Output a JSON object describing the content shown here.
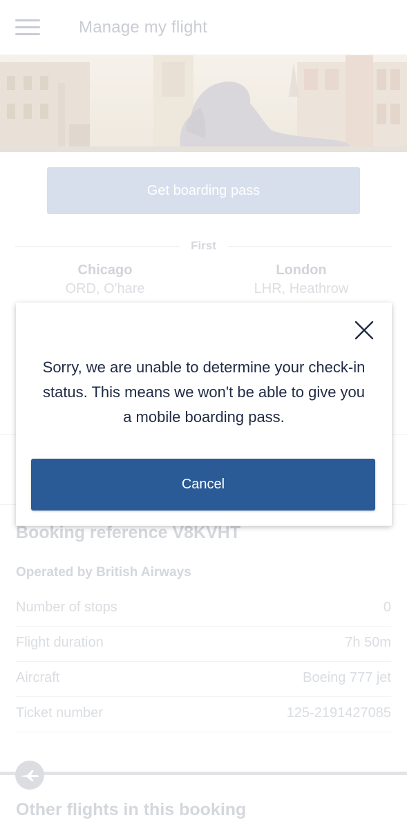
{
  "header": {
    "title": "Manage my flight",
    "menu_icon": "hamburger-menu-icon"
  },
  "hero": {
    "image": "london-trafalgar-lion-photo"
  },
  "boarding_pass": {
    "label": "Get boarding pass"
  },
  "flight": {
    "cabin": "First",
    "origin": {
      "city": "Chicago",
      "airport": "ORD, O'hare"
    },
    "destination": {
      "city": "London",
      "airport": "LHR, Heathrow"
    }
  },
  "booking": {
    "reference": "Booking reference V8KVHT",
    "operated_by": "Operated by British Airways",
    "details": [
      {
        "label": "Number of stops",
        "value": "0"
      },
      {
        "label": "Flight duration",
        "value": "7h 50m"
      },
      {
        "label": "Aircraft",
        "value": "Boeing 777 jet"
      },
      {
        "label": "Ticket number",
        "value": "125-2191427085"
      }
    ]
  },
  "other_flights": {
    "title": "Other flights in this booking"
  },
  "modal": {
    "message": "Sorry, we are unable to determine your check-in status. This means we won't be able to give you a mobile boarding pass.",
    "cancel_label": "Cancel",
    "close_icon": "close-icon"
  },
  "colors": {
    "primary": "#2b5b97",
    "disabled_button": "#d6dfeb",
    "faded_text": "#d4d7dc"
  }
}
